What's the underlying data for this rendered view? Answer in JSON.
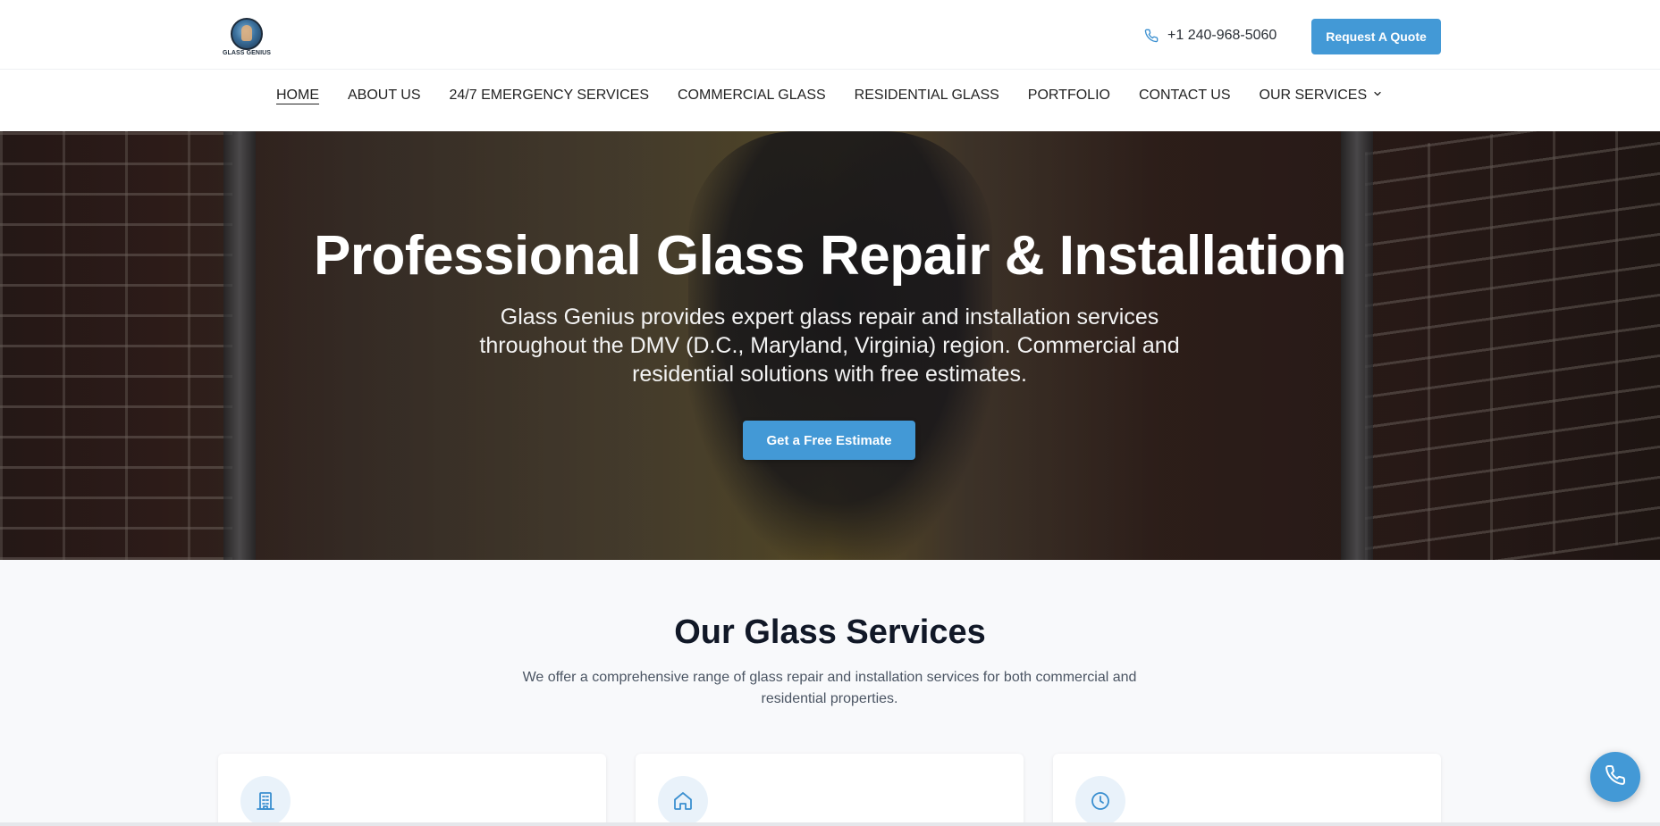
{
  "brand": {
    "logo_text": "GLASS GENIUS"
  },
  "header": {
    "phone": "+1 240-968-5060",
    "phone_icon": "phone-icon",
    "quote_label": "Request A Quote"
  },
  "nav": {
    "items": [
      {
        "label": "HOME",
        "active": true
      },
      {
        "label": "ABOUT US"
      },
      {
        "label": "24/7 EMERGENCY SERVICES"
      },
      {
        "label": "COMMERCIAL GLASS"
      },
      {
        "label": "RESIDENTIAL GLASS"
      },
      {
        "label": "PORTFOLIO"
      },
      {
        "label": "CONTACT US"
      },
      {
        "label": "OUR SERVICES",
        "has_dropdown": true
      }
    ]
  },
  "hero": {
    "title": "Professional Glass Repair & Installation",
    "subtitle": "Glass Genius provides expert glass repair and installation services throughout the DMV (D.C., Maryland, Virginia) region. Commercial and residential solutions with free estimates.",
    "cta_label": "Get a Free Estimate"
  },
  "services": {
    "title": "Our Glass Services",
    "subtitle": "We offer a comprehensive range of glass repair and installation services for both commercial and residential properties.",
    "cards": [
      {
        "icon": "building-icon"
      },
      {
        "icon": "home-icon"
      },
      {
        "icon": "clock-icon"
      }
    ]
  },
  "colors": {
    "accent": "#4399d6",
    "icon_bg": "#e9f2fa",
    "section_bg": "#f8f9fb"
  }
}
